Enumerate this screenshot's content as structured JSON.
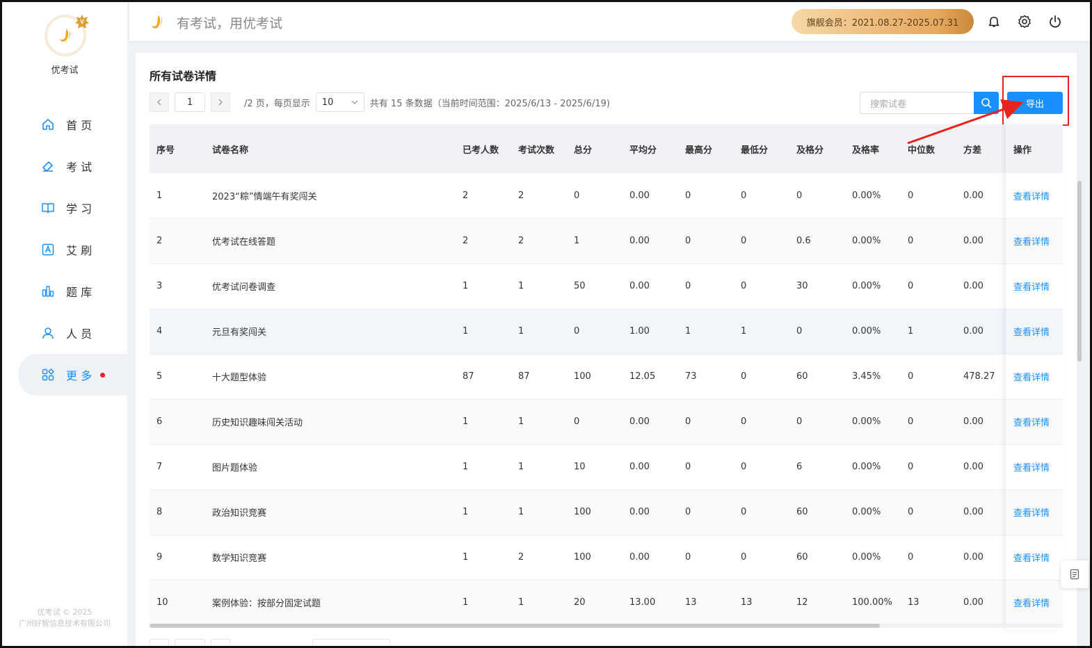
{
  "brand": {
    "name": "优考试",
    "slogan": "有考试，用优考试"
  },
  "sidebar": {
    "items": [
      {
        "label": "首 页",
        "icon": "home-icon"
      },
      {
        "label": "考 试",
        "icon": "eraser-icon"
      },
      {
        "label": "学 习",
        "icon": "book-icon"
      },
      {
        "label": "艾 刷",
        "icon": "a-square-icon"
      },
      {
        "label": "题 库",
        "icon": "bar-chart-icon"
      },
      {
        "label": "人 员",
        "icon": "user-icon"
      },
      {
        "label": "更 多",
        "icon": "apps-icon",
        "active": true,
        "badge": "red-dot"
      }
    ],
    "copyright_line1": "优考试 © 2025",
    "copyright_line2": "广州好智信息技术有限公司"
  },
  "header": {
    "vip_text": "旗舰会员：2021.08.27-2025.07.31",
    "icons": [
      "bell-icon",
      "gear-icon",
      "power-icon"
    ]
  },
  "main": {
    "title": "所有试卷详情",
    "pager": {
      "current_page": "1",
      "pages_text": "/2 页，每页显示",
      "page_size": "10",
      "summary": "共有 15 条数据（当前时间范围：2025/6/13 - 2025/6/19)"
    },
    "search": {
      "placeholder": "搜索试卷"
    },
    "export_label": "导出",
    "table": {
      "columns": [
        "序号",
        "试卷名称",
        "已考人数",
        "考试次数",
        "总分",
        "平均分",
        "最高分",
        "最低分",
        "及格分",
        "及格率",
        "中位数",
        "方差",
        "操作"
      ],
      "action_label": "查看详情",
      "rows": [
        [
          "1",
          "2023“粽”情端午有奖闯关",
          "2",
          "2",
          "0",
          "0.00",
          "0",
          "0",
          "0",
          "0.00%",
          "0",
          "0.00"
        ],
        [
          "2",
          "优考试在线答题",
          "2",
          "2",
          "1",
          "0.00",
          "0",
          "0",
          "0.6",
          "0.00%",
          "0",
          "0.00"
        ],
        [
          "3",
          "优考试问卷调查",
          "1",
          "1",
          "50",
          "0.00",
          "0",
          "0",
          "30",
          "0.00%",
          "0",
          "0.00"
        ],
        [
          "4",
          "元旦有奖闯关",
          "1",
          "1",
          "0",
          "1.00",
          "1",
          "1",
          "0",
          "0.00%",
          "1",
          "0.00"
        ],
        [
          "5",
          "十大题型体验",
          "87",
          "87",
          "100",
          "12.05",
          "73",
          "0",
          "60",
          "3.45%",
          "0",
          "478.27"
        ],
        [
          "6",
          "历史知识趣味闯关活动",
          "1",
          "1",
          "0",
          "0.00",
          "0",
          "0",
          "0",
          "0.00%",
          "0",
          "0.00"
        ],
        [
          "7",
          "图片题体验",
          "1",
          "1",
          "10",
          "0.00",
          "0",
          "0",
          "6",
          "0.00%",
          "0",
          "0.00"
        ],
        [
          "8",
          "政治知识竞赛",
          "1",
          "1",
          "100",
          "0.00",
          "0",
          "0",
          "60",
          "0.00%",
          "0",
          "0.00"
        ],
        [
          "9",
          "数学知识竞赛",
          "1",
          "2",
          "100",
          "0.00",
          "0",
          "0",
          "60",
          "0.00%",
          "0",
          "0.00"
        ],
        [
          "10",
          "案例体验：按部分固定试题",
          "1",
          "1",
          "20",
          "13.00",
          "13",
          "13",
          "12",
          "100.00%",
          "13",
          "0.00"
        ]
      ]
    }
  },
  "colors": {
    "primary": "#1890ff",
    "highlight": "#e8231b",
    "vip_gold": "#e6a860",
    "brand_orange": "#f5a623"
  }
}
